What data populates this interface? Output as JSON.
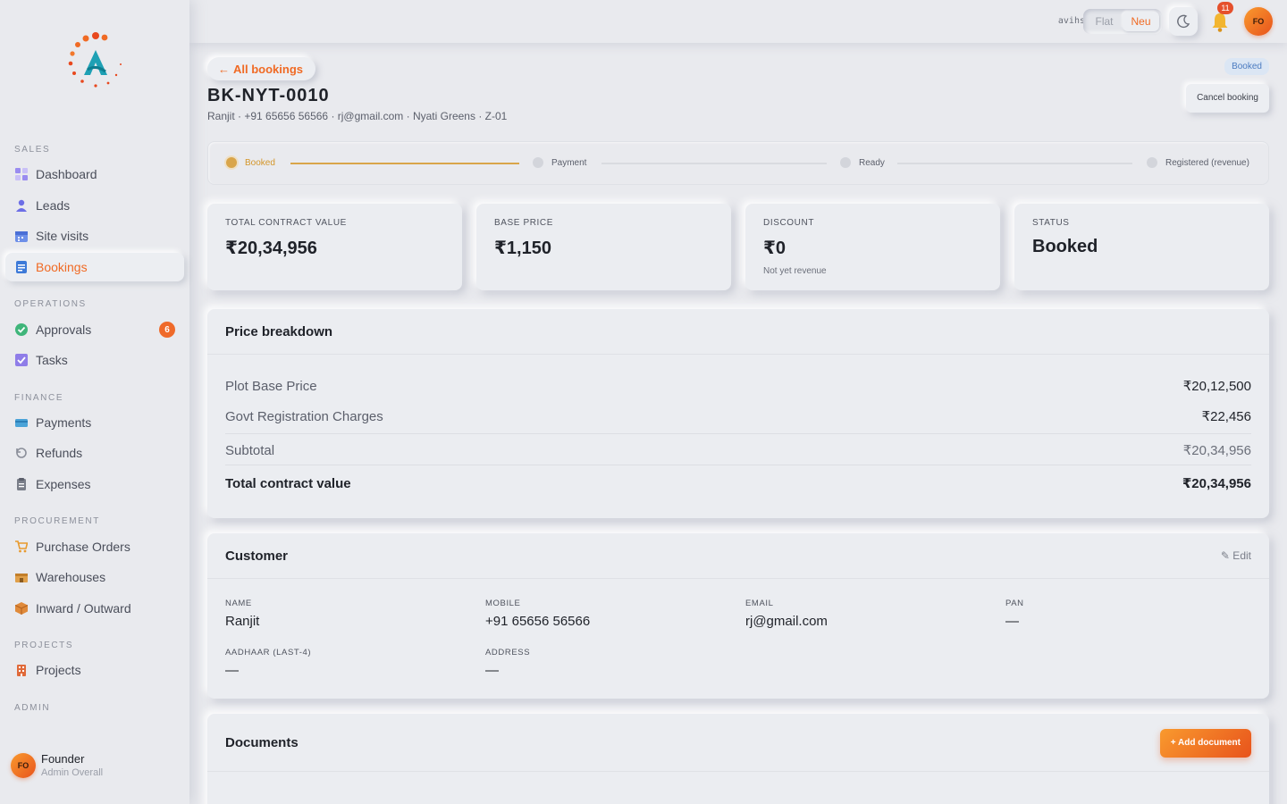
{
  "sidebar": {
    "sections": {
      "sales": "SALES",
      "operations": "OPERATIONS",
      "finance": "FINANCE",
      "procurement": "PROCUREMENT",
      "projects": "PROJECTS",
      "admin": "ADMIN"
    },
    "items": {
      "dashboard": "Dashboard",
      "leads": "Leads",
      "site_visits": "Site visits",
      "bookings": "Bookings",
      "approvals": "Approvals",
      "approvals_badge": "6",
      "tasks": "Tasks",
      "payments": "Payments",
      "refunds": "Refunds",
      "expenses": "Expenses",
      "purchase_orders": "Purchase Orders",
      "warehouses": "Warehouses",
      "inward_outward": "Inward / Outward",
      "projects": "Projects"
    },
    "user": {
      "initials": "FO",
      "name": "Founder",
      "role": "Admin Overall"
    }
  },
  "topbar": {
    "tenant": "avihs",
    "theme_options": [
      "Flat",
      "Neu"
    ],
    "theme_selected": "Neu",
    "notification_count": "11",
    "avatar_initials": "FO"
  },
  "header": {
    "back_label": "All bookings",
    "booking_id": "BK-NYT-0010",
    "subtitle": "Ranjit · +91 65656 56566 · rj@gmail.com · Nyati Greens · Z-01",
    "status_pill": "Booked",
    "cancel_label": "Cancel booking"
  },
  "stepper": {
    "steps": [
      "Booked",
      "Payment",
      "Ready",
      "Registered (revenue)"
    ],
    "current": 0
  },
  "kpis": [
    {
      "label": "TOTAL CONTRACT VALUE",
      "value": "₹20,34,956",
      "sub": ""
    },
    {
      "label": "BASE PRICE",
      "value": "₹1,150",
      "sub": ""
    },
    {
      "label": "DISCOUNT",
      "value": "₹0",
      "sub": "Not yet revenue"
    },
    {
      "label": "STATUS",
      "value": "Booked",
      "sub": ""
    }
  ],
  "price_breakdown": {
    "title": "Price breakdown",
    "rows": [
      {
        "label": "Plot Base Price",
        "value": "₹20,12,500"
      },
      {
        "label": "Govt Registration Charges",
        "value": "₹22,456"
      }
    ],
    "subtotal": {
      "label": "Subtotal",
      "value": "₹20,34,956"
    },
    "total": {
      "label": "Total contract value",
      "value": "₹20,34,956"
    }
  },
  "customer": {
    "title": "Customer",
    "edit_label": "✎ Edit",
    "fields": {
      "name": {
        "label": "NAME",
        "value": "Ranjit"
      },
      "mobile": {
        "label": "MOBILE",
        "value": "+91 65656 56566"
      },
      "email": {
        "label": "EMAIL",
        "value": "rj@gmail.com"
      },
      "pan": {
        "label": "PAN",
        "value": "—"
      },
      "aadhaar": {
        "label": "AADHAAR (LAST-4)",
        "value": "—"
      },
      "address": {
        "label": "ADDRESS",
        "value": "—"
      }
    }
  },
  "documents": {
    "title": "Documents",
    "add_label": "+ Add document"
  },
  "colors": {
    "accent": "#f06a24",
    "step_done": "#d9a54a",
    "background": "#e9eaee"
  }
}
